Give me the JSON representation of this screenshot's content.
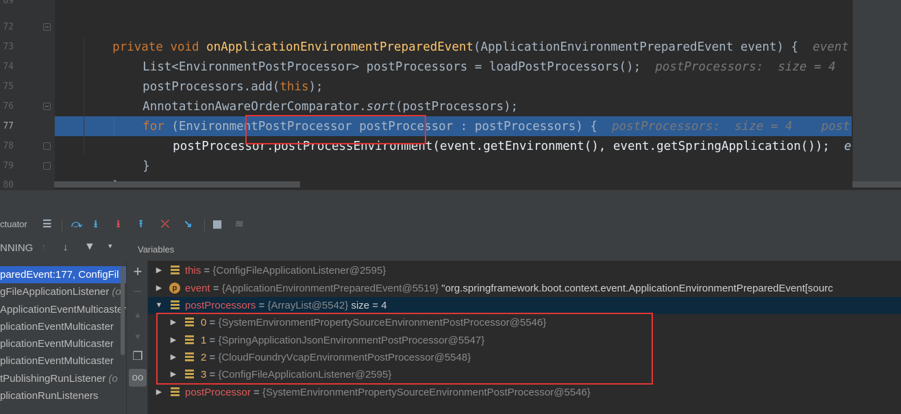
{
  "editor": {
    "line_numbers": [
      "69",
      "72",
      "73",
      "74",
      "75",
      "76",
      "77",
      "78",
      "79",
      "80"
    ],
    "lines": [
      {
        "parts": [
          "private void ",
          "onApplicationEnvironmentPreparedEvent",
          "(ApplicationEnvironmentPreparedEvent event) {"
        ],
        "hint": "event"
      },
      {
        "parts": [
          "List<EnvironmentPostProcessor> postProcessors = loadPostProcessors();"
        ],
        "hint": "postProcessors:  size = 4"
      },
      {
        "parts": [
          "postProcessors.add(",
          "this",
          ");"
        ]
      },
      {
        "parts": [
          "AnnotationAwareOrderComparator.",
          "sort",
          "(postProcessors);"
        ]
      },
      {
        "parts": [
          "for ",
          "(EnvironmentPostProcessor postProcessor : postProcessors) {"
        ],
        "hint": "postProcessors:  size = 4    post"
      },
      {
        "parts": [
          "postProcessor.",
          "postProcessEnvironment",
          "(event.getEnvironment(), event.getSpringApplication());"
        ],
        "hint": "e"
      },
      {
        "parts": [
          "}"
        ]
      },
      {
        "parts": [
          "}"
        ]
      }
    ]
  },
  "debug": {
    "actuator_label": "ctuator",
    "variables_label": "Variables",
    "thread_state": "NNING",
    "frames": [
      {
        "text": "paredEvent:177, ConfigFil",
        "selected": true
      },
      {
        "text": "gFileApplicationListener",
        "dim": " (o"
      },
      {
        "text": "ApplicationEventMulticaster",
        "dim": ""
      },
      {
        "text": "plicationEventMulticaster",
        "dim": ""
      },
      {
        "text": "plicationEventMulticaster",
        "dim": ""
      },
      {
        "text": "plicationEventMulticaster",
        "dim": ""
      },
      {
        "text": "tPublishingRunListener",
        "dim": " (o"
      },
      {
        "text": "plicationRunListeners",
        "dim": ""
      }
    ],
    "variables": [
      {
        "name": "this",
        "value": "{ConfigFileApplicationListener@2595}"
      },
      {
        "name": "event",
        "value": "{ApplicationEnvironmentPreparedEvent@5519}",
        "text": " \"org.springframework.boot.context.event.ApplicationEnvironmentPreparedEvent[sourc"
      },
      {
        "name": "postProcessors",
        "value": "{ArrayList@5542}",
        "text": "  size = 4"
      },
      {
        "name": "0",
        "value": "{SystemEnvironmentPropertySourceEnvironmentPostProcessor@5546}"
      },
      {
        "name": "1",
        "value": "{SpringApplicationJsonEnvironmentPostProcessor@5547}"
      },
      {
        "name": "2",
        "value": "{CloudFoundryVcapEnvironmentPostProcessor@5548}"
      },
      {
        "name": "3",
        "value": "{ConfigFileApplicationListener@2595}"
      },
      {
        "name": "postProcessor",
        "value": "{SystemEnvironmentPropertySourceEnvironmentPostProcessor@5546}"
      }
    ]
  },
  "colors": {
    "keyword": "#cc7832",
    "method": "#ffc66d",
    "exec_line": "#2d5c95",
    "highlight_box": "#e33636",
    "var_name": "#e05a5a"
  }
}
